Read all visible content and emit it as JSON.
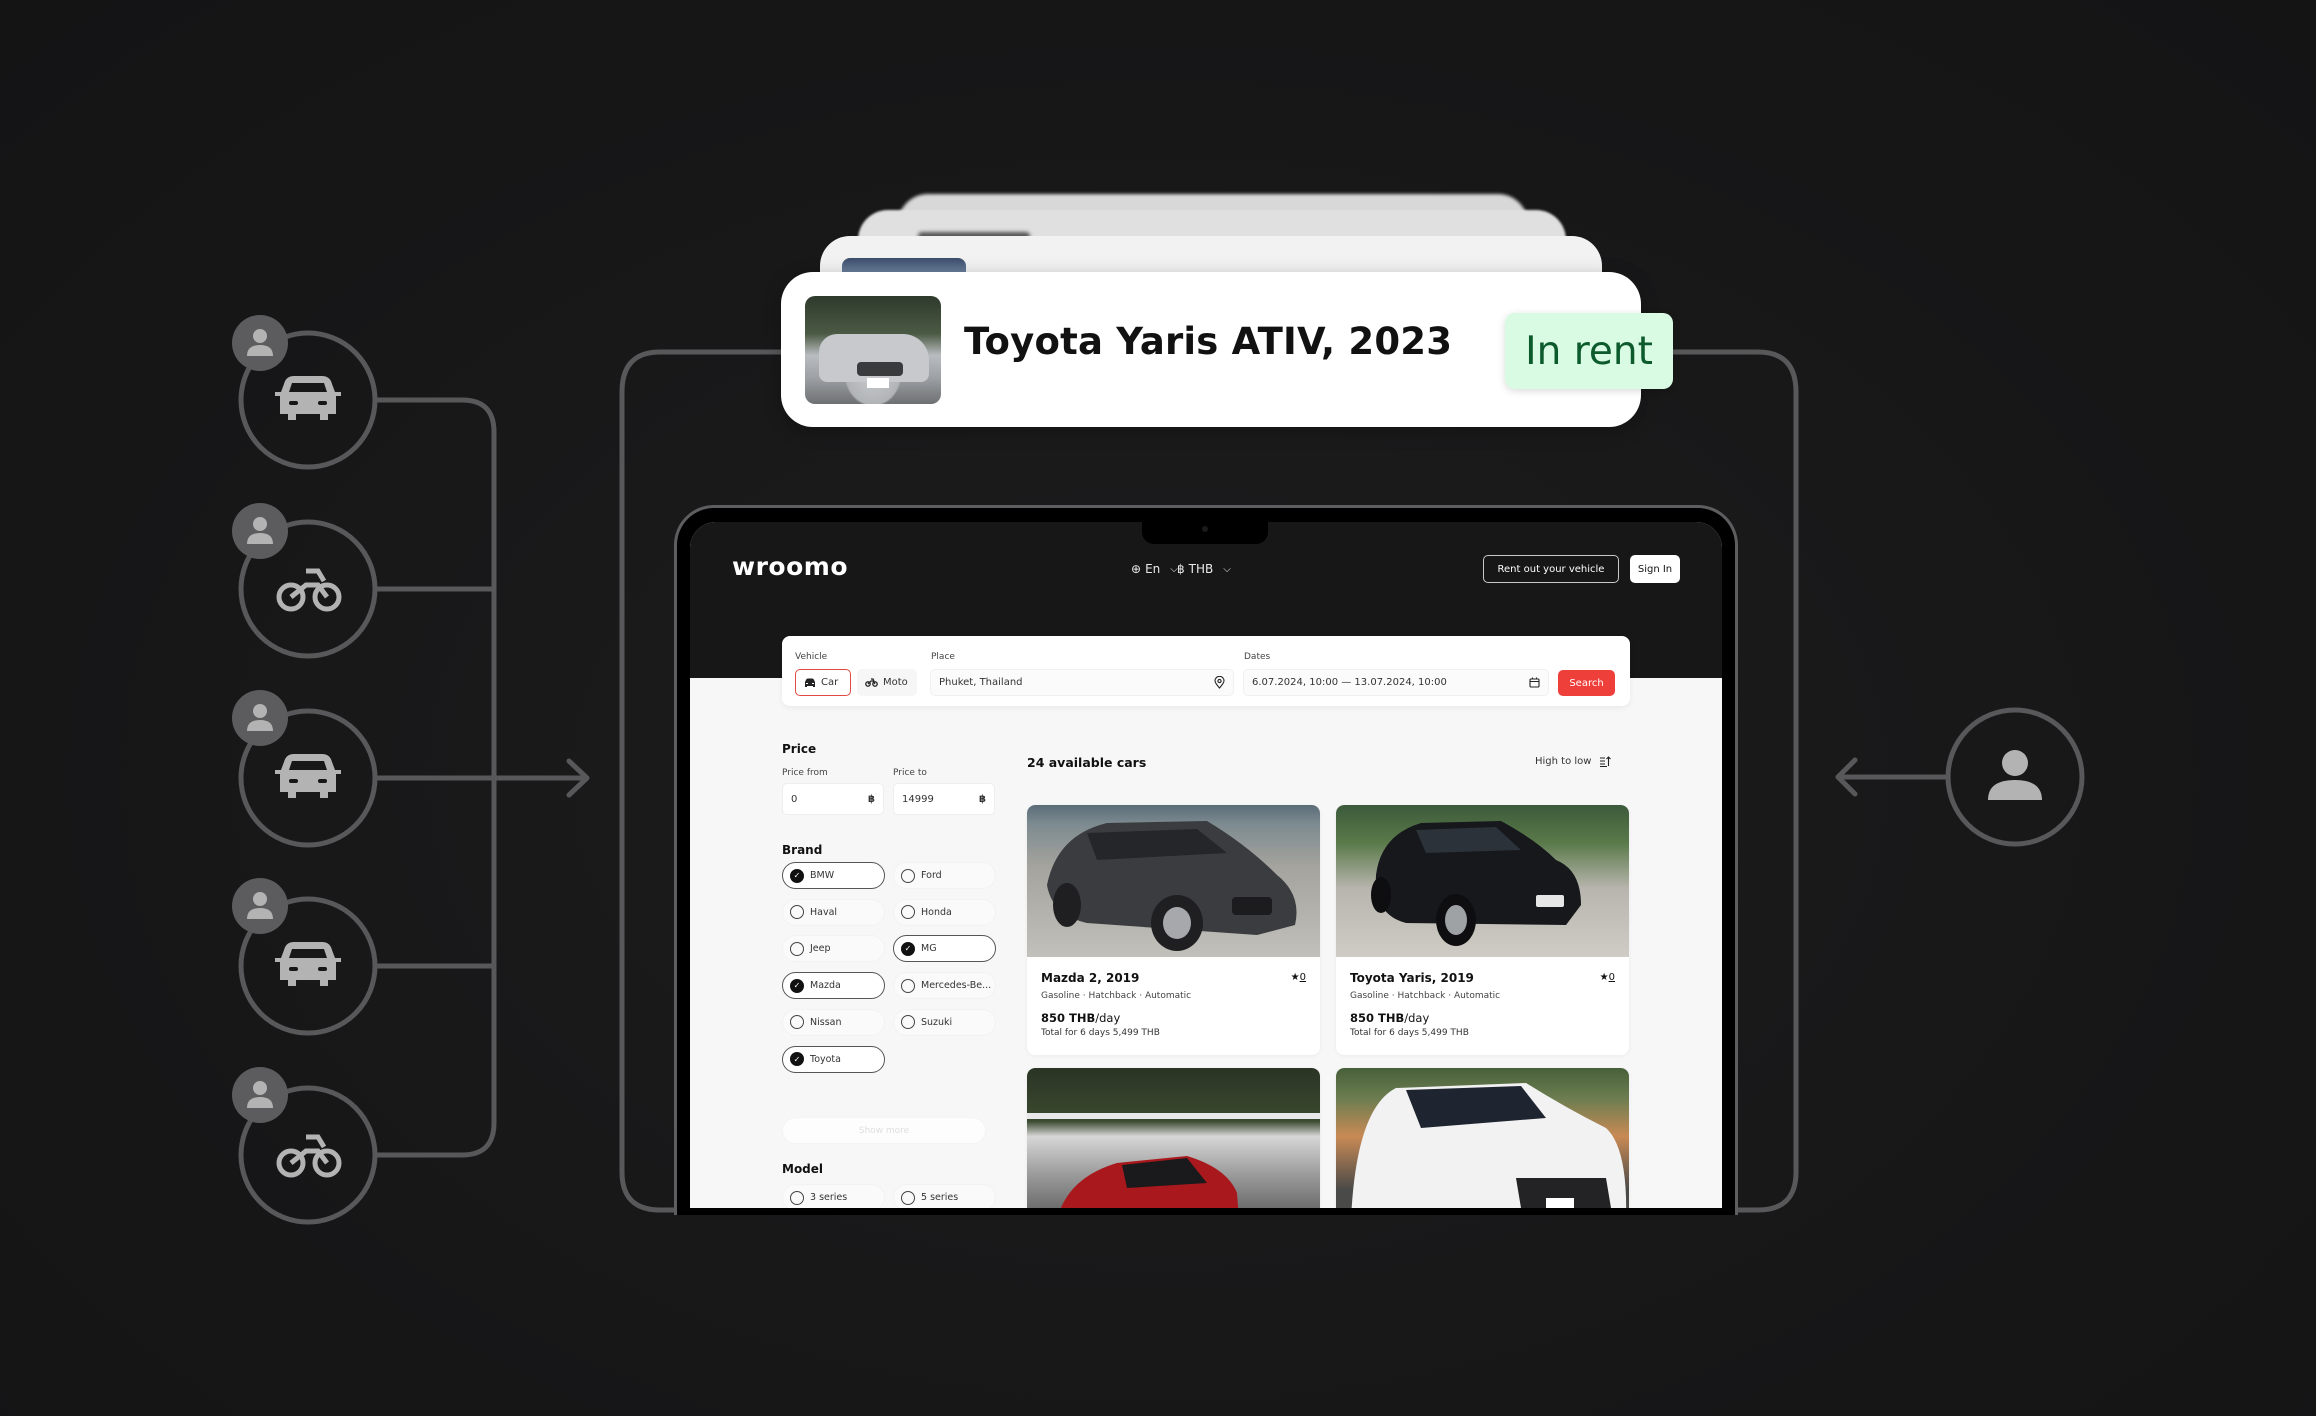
{
  "status_card": {
    "title": "Toyota Yaris ATIV, 2023",
    "badge": "In rent",
    "badge_bg": "#d9fbe4",
    "badge_fg": "#0d5a2c"
  },
  "diagram": {
    "owners": [
      {
        "vehicle_icon": "car-icon"
      },
      {
        "vehicle_icon": "motorcycle-icon"
      },
      {
        "vehicle_icon": "car-icon"
      },
      {
        "vehicle_icon": "car-icon"
      },
      {
        "vehicle_icon": "motorcycle-icon"
      }
    ],
    "renter_icon": "user-icon"
  },
  "app": {
    "logo": "wroomo",
    "language": "En",
    "currency": "THB",
    "currency_symbol": "฿",
    "rent_out_label": "Rent out your vehicle",
    "sign_in_label": "Sign In",
    "accent": "#ef3f3a"
  },
  "search": {
    "vehicle_label": "Vehicle",
    "vehicle_options": [
      "Car",
      "Moto"
    ],
    "vehicle_selected": "Car",
    "place_label": "Place",
    "place_value": "Phuket, Thailand",
    "dates_label": "Dates",
    "dates_value": "6.07.2024, 10:00 — 13.07.2024, 10:00",
    "search_label": "Search"
  },
  "filters": {
    "price_title": "Price",
    "price_from_label": "Price from",
    "price_from_value": "0",
    "price_to_label": "Price to",
    "price_to_value": "14999",
    "currency_symbol": "฿",
    "brand_title": "Brand",
    "brands": [
      {
        "label": "BMW",
        "checked": true
      },
      {
        "label": "Ford",
        "checked": false
      },
      {
        "label": "Haval",
        "checked": false
      },
      {
        "label": "Honda",
        "checked": false
      },
      {
        "label": "Jeep",
        "checked": false
      },
      {
        "label": "MG",
        "checked": true
      },
      {
        "label": "Mazda",
        "checked": true
      },
      {
        "label": "Mercedes-Be...",
        "checked": false
      },
      {
        "label": "Nissan",
        "checked": false
      },
      {
        "label": "Suzuki",
        "checked": false
      },
      {
        "label": "Toyota",
        "checked": true
      }
    ],
    "show_more_label": "Show more",
    "model_title": "Model",
    "models": [
      {
        "label": "3 series",
        "checked": false
      },
      {
        "label": "5 series",
        "checked": false
      }
    ]
  },
  "results": {
    "count_label": "24 available cars",
    "sort_label": "High to low",
    "cards": [
      {
        "title": "Mazda 2, 2019",
        "rating": "0",
        "specs": "Gasoline · Hatchback · Automatic",
        "price": "850 THB",
        "per": "/day",
        "total": "Total for  6 days 5,499 THB"
      },
      {
        "title": "Toyota Yaris, 2019",
        "rating": "0",
        "specs": "Gasoline · Hatchback · Automatic",
        "price": "850 THB",
        "per": "/day",
        "total": "Total for  6 days 5,499 THB"
      },
      {
        "title": "",
        "rating": "",
        "specs": "",
        "price": "",
        "per": "",
        "total": ""
      },
      {
        "title": "",
        "rating": "",
        "specs": "",
        "price": "",
        "per": "",
        "total": ""
      }
    ]
  }
}
